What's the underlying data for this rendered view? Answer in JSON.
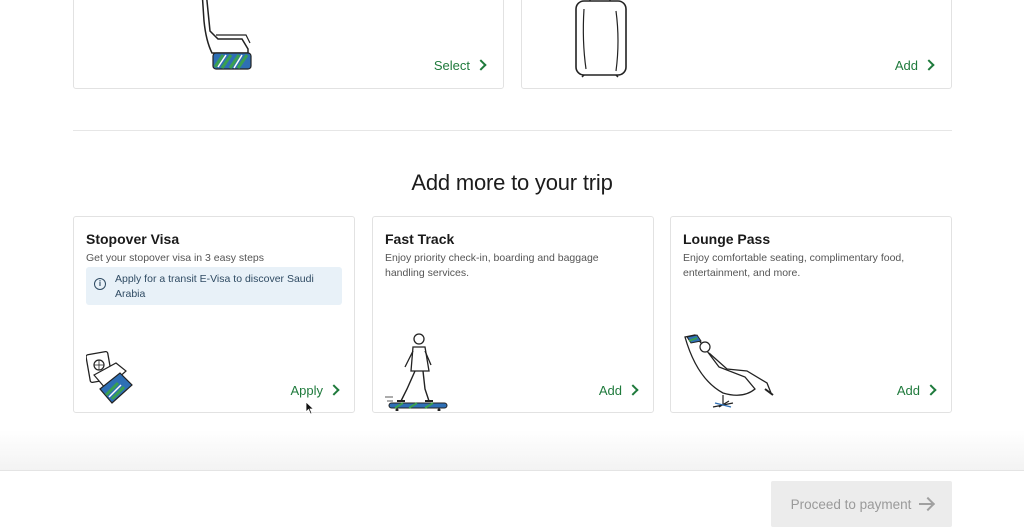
{
  "top_cards": [
    {
      "cta_label": "Select",
      "icon": "seat-icon"
    },
    {
      "cta_label": "Add",
      "icon": "luggage-icon"
    }
  ],
  "section": {
    "title": "Add more to your trip"
  },
  "cards": [
    {
      "title": "Stopover Visa",
      "description": "Get your stopover visa in 3 easy steps",
      "info": "Apply for a transit E-Visa to discover Saudi Arabia",
      "cta_label": "Apply",
      "icon": "passport-icon"
    },
    {
      "title": "Fast Track",
      "description": "Enjoy priority check-in, boarding and baggage handling services.",
      "cta_label": "Add",
      "icon": "skateboarder-icon"
    },
    {
      "title": "Lounge Pass",
      "description": "Enjoy comfortable seating, complimentary food, entertainment, and more.",
      "cta_label": "Add",
      "icon": "lounge-chair-icon"
    }
  ],
  "footer": {
    "proceed_label": "Proceed to payment"
  },
  "colors": {
    "accent": "#1f7a3c",
    "info_bg": "#e8f1f8",
    "disabled_bg": "#ececec"
  }
}
